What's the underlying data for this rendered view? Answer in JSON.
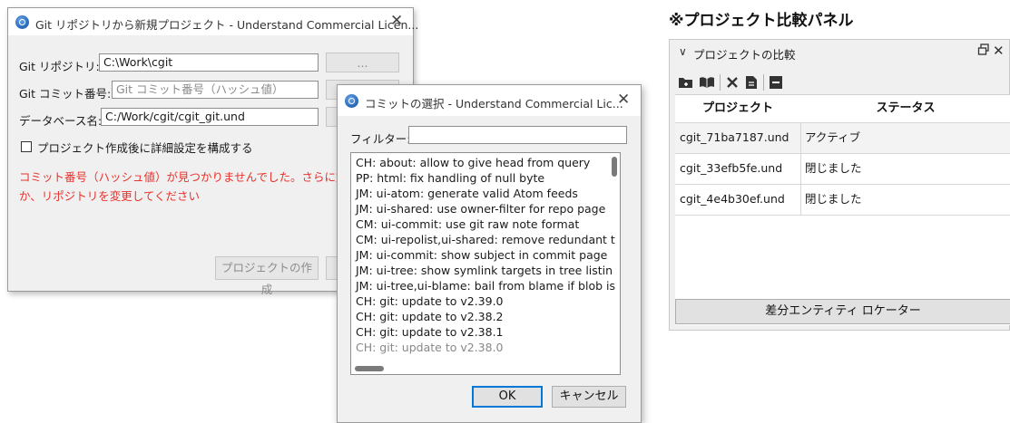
{
  "dialog_git": {
    "title": "Git リポジトリから新規プロジェクト - Understand Commercial Licen...",
    "repo_label": "Git リポジトリ:",
    "repo_value": "C:\\Work\\cgit",
    "browse_label": "...",
    "commit_label": "Git コミット番号:",
    "commit_placeholder": "Git コミット番号（ハッシュ値）",
    "db_label": "データベース名:",
    "db_value": "C:/Work/cgit/cgit_git.und",
    "checkbox_label": "プロジェクト作成後に詳細設定を構成する",
    "error_line1": "コミット番号（ハッシュ値）が見つかりませんでした。さらに文字",
    "error_line2": "か、リポジトリを変更してください",
    "create_button": "プロジェクトの作成"
  },
  "dialog_commit": {
    "title": "コミットの選択 - Understand Commercial Lic...",
    "filter_label": "フィルター:",
    "filter_value": "",
    "commits": [
      "CH: about: allow to give head from query",
      "PP: html: fix handling of null byte",
      "JM: ui-atom: generate valid Atom feeds",
      "JM: ui-shared: use owner-filter for repo page",
      "CM: ui-commit: use git raw note format",
      "CM: ui-repolist,ui-shared: remove redundant t",
      "JM: ui-commit: show subject in commit page",
      "JM: ui-tree: show symlink targets in tree listin",
      "JM: ui-tree,ui-blame: bail from blame if blob is",
      "CH: git: update to v2.39.0",
      "CH: git: update to v2.38.2",
      "CH: git: update to v2.38.1"
    ],
    "ok_label": "OK",
    "cancel_label": "キャンセル"
  },
  "panel": {
    "heading": "※プロジェクト比較パネル",
    "title": "プロジェクトの比較",
    "col_project": "プロジェクト",
    "col_status": "ステータス",
    "rows": [
      {
        "project": "cgit_71ba7187.und",
        "status": "アクティブ"
      },
      {
        "project": "cgit_33efb5fe.und",
        "status": "閉じました"
      },
      {
        "project": "cgit_4e4b30ef.und",
        "status": "閉じました"
      }
    ],
    "locator_button": "差分エンティティ ロケーター",
    "toolbar_icons": [
      "add-folder-icon",
      "open-book-icon",
      "delete-icon",
      "document-icon",
      "collapse-icon"
    ],
    "accent_color": "#0078d7",
    "error_color": "#e8322c"
  }
}
